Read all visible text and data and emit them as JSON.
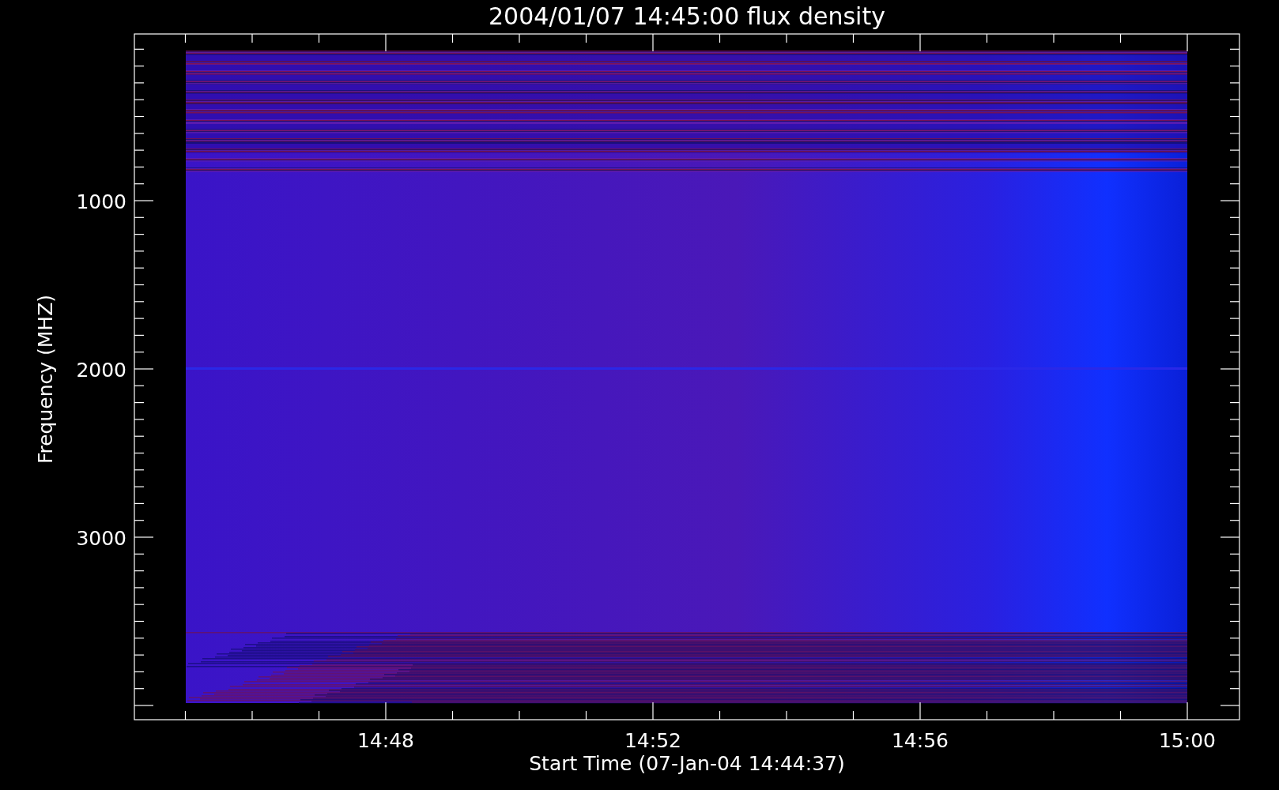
{
  "title": "2004/01/07 14:45:00 flux density",
  "y_axis": {
    "label": "Frequency (MHZ)",
    "tick_labels": [
      "1000",
      "2000",
      "3000"
    ]
  },
  "x_axis": {
    "label": "Start Time (07-Jan-04 14:44:37)",
    "tick_labels": [
      "14:48",
      "14:52",
      "14:56",
      "15:00"
    ]
  }
}
